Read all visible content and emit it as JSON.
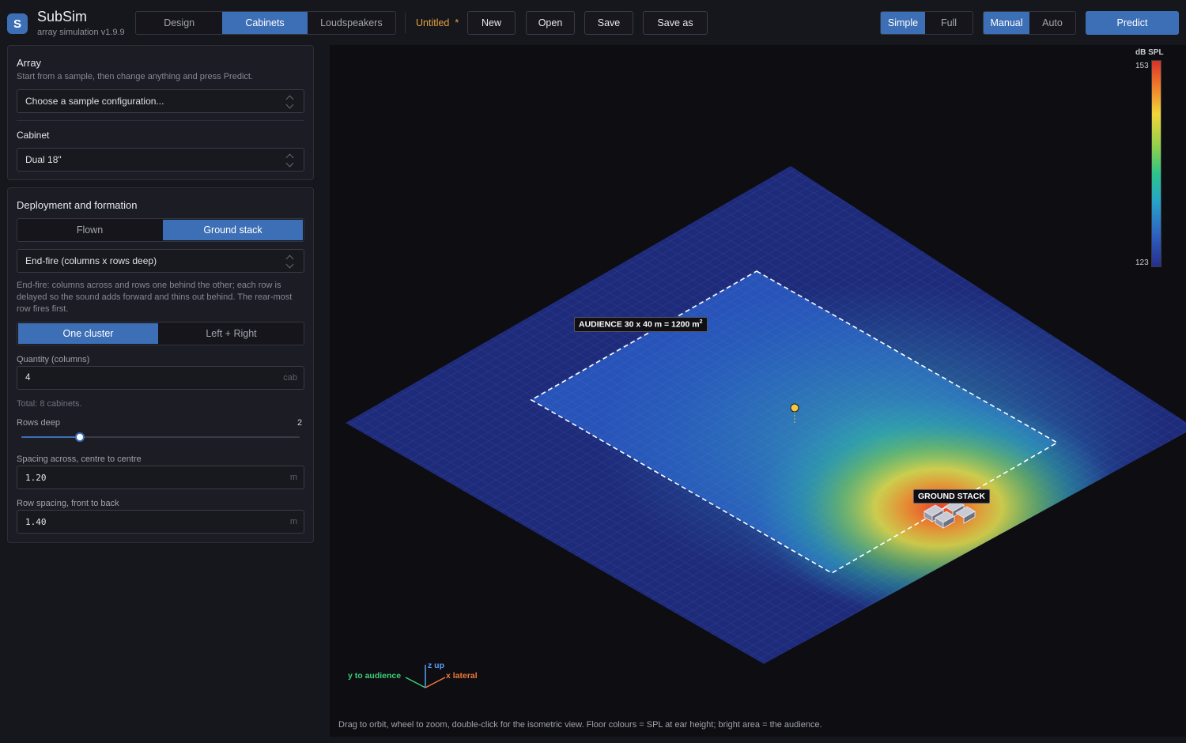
{
  "app": {
    "logo": "S",
    "title": "SubSim",
    "subtitle": "array simulation  v1.9.9"
  },
  "tabs": [
    {
      "label": "Design",
      "active": false
    },
    {
      "label": "Cabinets",
      "active": true
    },
    {
      "label": "Loudspeakers",
      "active": false
    }
  ],
  "document": {
    "name": "Untitled",
    "dirty_mark": "*"
  },
  "toolbar": {
    "new": "New",
    "open": "Open",
    "save": "Save",
    "save_as": "Save as"
  },
  "view_mode": {
    "simple": "Simple",
    "full": "Full",
    "selected": "Simple"
  },
  "run_mode": {
    "manual": "Manual",
    "auto": "Auto",
    "selected": "Manual"
  },
  "predict_label": "Predict",
  "array_panel": {
    "title": "Array",
    "subtitle": "Start from a sample, then change anything and press Predict.",
    "sample_select": "Choose a sample configuration...",
    "cabinet_label": "Cabinet",
    "cabinet_value": "Dual 18\""
  },
  "deploy_panel": {
    "title": "Deployment and formation",
    "deployment": {
      "flown": "Flown",
      "ground": "Ground stack",
      "selected": "Ground stack"
    },
    "formation_select": "End-fire  (columns x rows deep)",
    "formation_desc": "End-fire: columns across and rows one behind the other; each row is delayed so the sound adds forward and thins out behind. The rear-most row fires first.",
    "cluster": {
      "one": "One cluster",
      "lr": "Left + Right",
      "selected": "One cluster"
    },
    "quantity_label": "Quantity (columns)",
    "quantity_value": "4",
    "quantity_unit": "cab",
    "total_text": "Total: 8 cabinets.",
    "rows_label": "Rows deep",
    "rows_value": "2",
    "rows_fraction": 0.21,
    "spacing_label": "Spacing across, centre to centre",
    "spacing_value": "1.20",
    "spacing_unit": "m",
    "row_spacing_label": "Row spacing, front to back",
    "row_spacing_value": "1.40",
    "row_spacing_unit": "m"
  },
  "viewport": {
    "legend_title": "dB SPL",
    "legend_max": "153",
    "legend_min": "123",
    "audience_label_prefix": "AUDIENCE  30 x 40 m  =  1200 m",
    "audience_label_sup": "2",
    "stack_label": "GROUND STACK",
    "axis_y": "y to audience",
    "axis_z": "z up",
    "axis_x": "x lateral",
    "hint": "Drag to orbit, wheel to zoom, double-click for the isometric view.  Floor colours = SPL at ear height; bright area = the audience.",
    "colors": {
      "accent": "#3d6fb6",
      "hot": "#e8402a",
      "cold": "#1e2a7a",
      "dirty": "#e8a33a"
    }
  }
}
